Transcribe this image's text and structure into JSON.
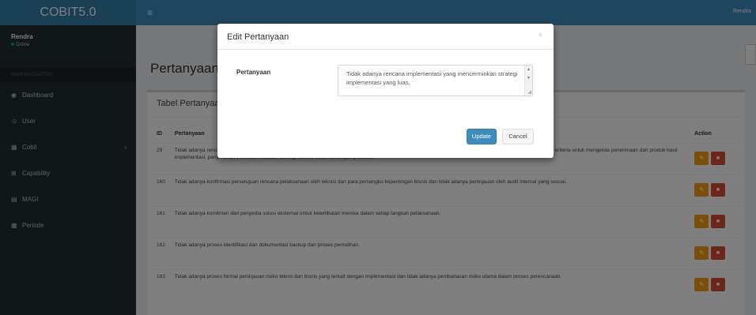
{
  "app": {
    "logo": "COBIT5.0",
    "menu_toggle": "≡",
    "user_short": "Rendra"
  },
  "sidebar": {
    "user_name": "Rendra",
    "user_status": "Online",
    "section_header": "MAIN NAVIGATION",
    "items": [
      {
        "label": "Dashboard",
        "icon": "dashboard-icon",
        "glyph": "◉"
      },
      {
        "label": "User",
        "icon": "user-icon",
        "glyph": "☺"
      },
      {
        "label": "Cobit",
        "icon": "grid-icon",
        "glyph": "▦",
        "chevron": "‹"
      },
      {
        "label": "Capability",
        "icon": "chart-icon",
        "glyph": "⊞"
      },
      {
        "label": "MAGI",
        "icon": "table-icon",
        "glyph": "▤"
      },
      {
        "label": "Periode",
        "icon": "calendar-icon",
        "glyph": "▦"
      }
    ]
  },
  "page": {
    "title": "Pertanyaan",
    "table_title": "Tabel Pertanyaan"
  },
  "table": {
    "headers": {
      "id": "ID",
      "question": "Pertanyaan",
      "action": "Action"
    },
    "rows": [
      {
        "id": "29",
        "text": "Tidak adanya rencana implementasi yang mencerminkan strategi implementasi yang luas, urutan langkah-langkah, perencanaan sumber daya, saling ketergantungan, kriteria untuk mengelola penerimaan dari produk hasil implementasi, penyerahan verifikasi instalasi, strategi transisi untuk dukungan produksi."
      },
      {
        "id": "160",
        "text": "Tidak adanya konfirmasi persetujuan rencana pelaksanaan oleh teknisi dan para pemangku kepentingan bisnis dan tidak adanya peninjauan oleh audit internal yang sesuai."
      },
      {
        "id": "161",
        "text": "Tidak adanya komitmen dari penyedia solusi eksternal untuk keterlibatan mereka dalam setiap langkah pelaksanaan."
      },
      {
        "id": "162",
        "text": "Tidak adanya proses identifikasi dan dokumentasi backup dan proses pemulihan."
      },
      {
        "id": "163",
        "text": "Tidak adanya proses formal peninjauan risiko teknis dan bisnis yang terkait dengan implementasi dan tidak adanya pembahasan risiko utama dalam proses perencanaan."
      }
    ],
    "edit_glyph": "✎",
    "delete_glyph": "■"
  },
  "modal": {
    "title": "Edit Pertanyaan",
    "close": "×",
    "field_label": "Pertanyaan",
    "field_value": "Tidak adanya rencana implementasi yang mencerminkan strategi implementasi yang luas,",
    "update_label": "Update",
    "cancel_label": "Cancel"
  },
  "colors": {
    "primary": "#3c8dbc",
    "sidebar": "#222d32",
    "edit": "#f39c12",
    "delete": "#dd4b39"
  }
}
